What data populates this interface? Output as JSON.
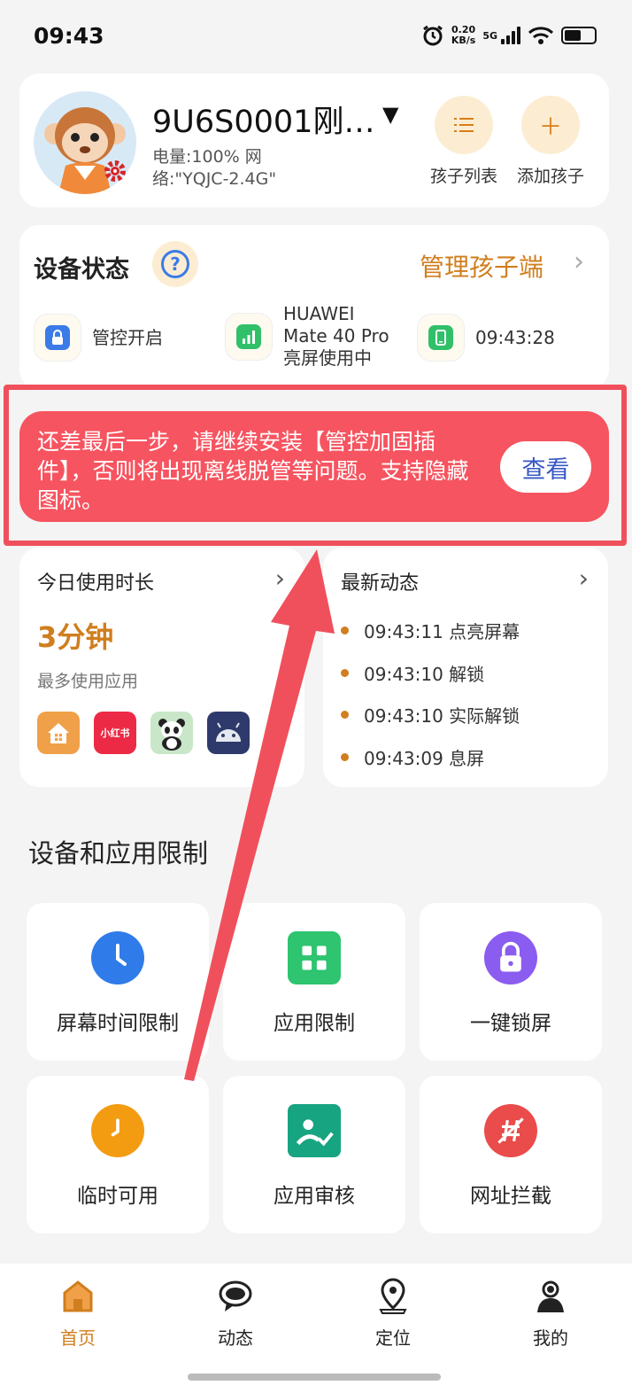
{
  "status_bar": {
    "time": "09:43",
    "net_speed_value": "0.20",
    "net_speed_unit": "KB/s",
    "network": "5G",
    "alarm_icon": "alarm-icon",
    "wifi_icon": "wifi-icon",
    "battery_icon": "battery-icon"
  },
  "profile": {
    "name": "9U6S0001刚…",
    "status": "电量:100% 网络:\"YQJC-2.4G\"",
    "buttons": [
      {
        "label": "孩子列表",
        "icon": "list-icon"
      },
      {
        "label": "添加孩子",
        "icon": "plus-icon"
      }
    ]
  },
  "device_status": {
    "title": "设备状态",
    "manage_label": "管理孩子端",
    "items": [
      {
        "text": "管控开启",
        "icon": "lock-icon",
        "color": "#3b7be8"
      },
      {
        "text": "HUAWEI Mate 40 Pro 亮屏使用中",
        "line1": "HUAWEI",
        "line2": "Mate 40 Pro",
        "line3": "亮屏使用中",
        "icon": "signal-bars-icon",
        "color": "#31c06a"
      },
      {
        "text": "09:43:28",
        "icon": "phone-icon",
        "color": "#31c06a"
      }
    ]
  },
  "banner": {
    "text": "还差最后一步，请继续安装【管控加固插件】，否则将出现离线脱管等问题。支持隐藏图标。",
    "button": "查看"
  },
  "usage": {
    "title": "今日使用时长",
    "value": "3分钟",
    "subtitle": "最多使用应用",
    "apps": [
      {
        "name": "home-launcher-app-icon",
        "color": "#f0a048"
      },
      {
        "name": "xiaohongshu-app-icon",
        "label": "小红书",
        "color": "#ec2a45"
      },
      {
        "name": "panda-app-icon",
        "color": "#c9e7c8"
      },
      {
        "name": "android-app-icon",
        "color": "#2e3a6b"
      }
    ]
  },
  "events": {
    "title": "最新动态",
    "items": [
      "09:43:11 点亮屏幕",
      "09:43:10 解锁",
      "09:43:10 实际解锁",
      "09:43:09 息屏"
    ]
  },
  "restrictions": {
    "title": "设备和应用限制",
    "tiles": [
      {
        "label": "屏幕时间限制",
        "icon": "clock-icon",
        "color": "#2f7bea"
      },
      {
        "label": "应用限制",
        "icon": "grid-icon",
        "color": "#2ec470"
      },
      {
        "label": "一键锁屏",
        "icon": "lock-icon",
        "color": "#8b5cf0"
      },
      {
        "label": "临时可用",
        "icon": "clock-icon",
        "color": "#f39c12"
      },
      {
        "label": "应用审核",
        "icon": "review-icon",
        "color": "#17a481"
      },
      {
        "label": "网址拦截",
        "icon": "url-block-icon",
        "color": "#ea4b4b"
      }
    ]
  },
  "tabs": [
    {
      "label": "首页",
      "icon": "home-icon",
      "active": true
    },
    {
      "label": "动态",
      "icon": "chat-bubble-icon",
      "active": false
    },
    {
      "label": "定位",
      "icon": "location-pin-icon",
      "active": false
    },
    {
      "label": "我的",
      "icon": "person-icon",
      "active": false
    }
  ],
  "colors": {
    "accent": "#d07e1e",
    "banner": "#f65460",
    "highlight": "#f0505c"
  }
}
